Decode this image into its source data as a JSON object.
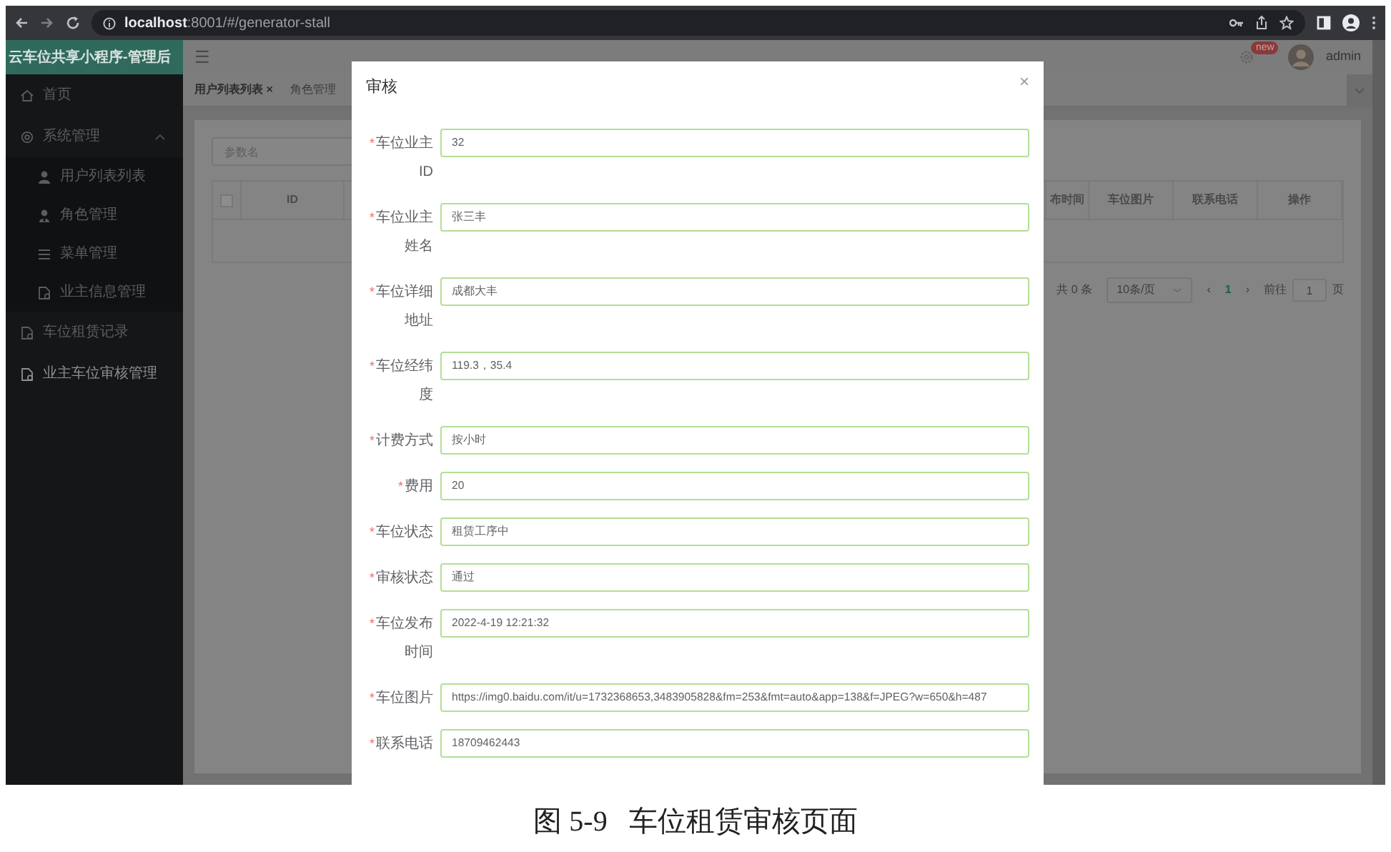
{
  "browser": {
    "url_host": "localhost",
    "url_path": ":8001/#/generator-stall"
  },
  "app": {
    "logo": "云车位共享小程序-管理后"
  },
  "header": {
    "menu_glyph": "☰",
    "badge": "new",
    "user": "admin"
  },
  "sidebar": [
    {
      "label": "首页",
      "selected": false
    },
    {
      "label": "系统管理",
      "selected": false,
      "expanded": true,
      "children": [
        {
          "label": "用户列表列表",
          "selected": false
        },
        {
          "label": "角色管理",
          "selected": false
        },
        {
          "label": "菜单管理",
          "selected": false
        },
        {
          "label": "业主信息管理",
          "selected": false
        }
      ]
    },
    {
      "label": "车位租赁记录",
      "selected": false
    },
    {
      "label": "业主车位审核管理",
      "selected": true
    }
  ],
  "tabs": [
    {
      "label": "用户列表列表",
      "close": "×",
      "selected": true
    },
    {
      "label": "角色管理",
      "selected": false
    }
  ],
  "search": {
    "placeholder": "参数名"
  },
  "table": {
    "columns": [
      {
        "kind": "checkbox",
        "checked": false
      },
      {
        "kind": "text",
        "label": "ID"
      },
      {
        "kind": "hidden"
      },
      {
        "kind": "text",
        "label": "布时间"
      },
      {
        "kind": "text",
        "label": "车位图片"
      },
      {
        "kind": "text",
        "label": "联系电话"
      },
      {
        "kind": "text",
        "label": "操作"
      }
    ]
  },
  "pagination": {
    "total": "共 0 条",
    "page_size": "10条/页",
    "prev": "‹",
    "page": "1",
    "next": "›",
    "goto_label": "前往",
    "goto_value": "1",
    "goto_suffix": "页"
  },
  "dialog": {
    "title": "审核",
    "close": "×",
    "fields": [
      {
        "label": "车位业主ID",
        "required_mark": "*",
        "value": "32"
      },
      {
        "label": "车位业主姓名",
        "required_mark": "*",
        "value": "张三丰"
      },
      {
        "label": "车位详细地址",
        "required_mark": "*",
        "value": "成都大丰"
      },
      {
        "label": "车位经纬度",
        "required_mark": "*",
        "value": "119.3，35.4"
      },
      {
        "label": "计费方式",
        "required_mark": "*",
        "value": "按小时"
      },
      {
        "label": "费用",
        "required_mark": "*",
        "value": "20"
      },
      {
        "label": "车位状态",
        "required_mark": "*",
        "value": "租赁工序中"
      },
      {
        "label": "审核状态",
        "required_mark": "*",
        "value": "通过"
      },
      {
        "label": "车位发布时间",
        "required_mark": "*",
        "value": "2022-4-19 12:21:32"
      },
      {
        "label": "车位图片",
        "required_mark": "*",
        "value": "https://img0.baidu.com/it/u=1732368653,3483905828&fm=253&fmt=auto&app=138&f=JPEG?w=650&h=487"
      },
      {
        "label": "联系电话",
        "required_mark": "*",
        "value": "18709462443"
      }
    ]
  },
  "caption": "图 5-9   车位租赁审核页面"
}
